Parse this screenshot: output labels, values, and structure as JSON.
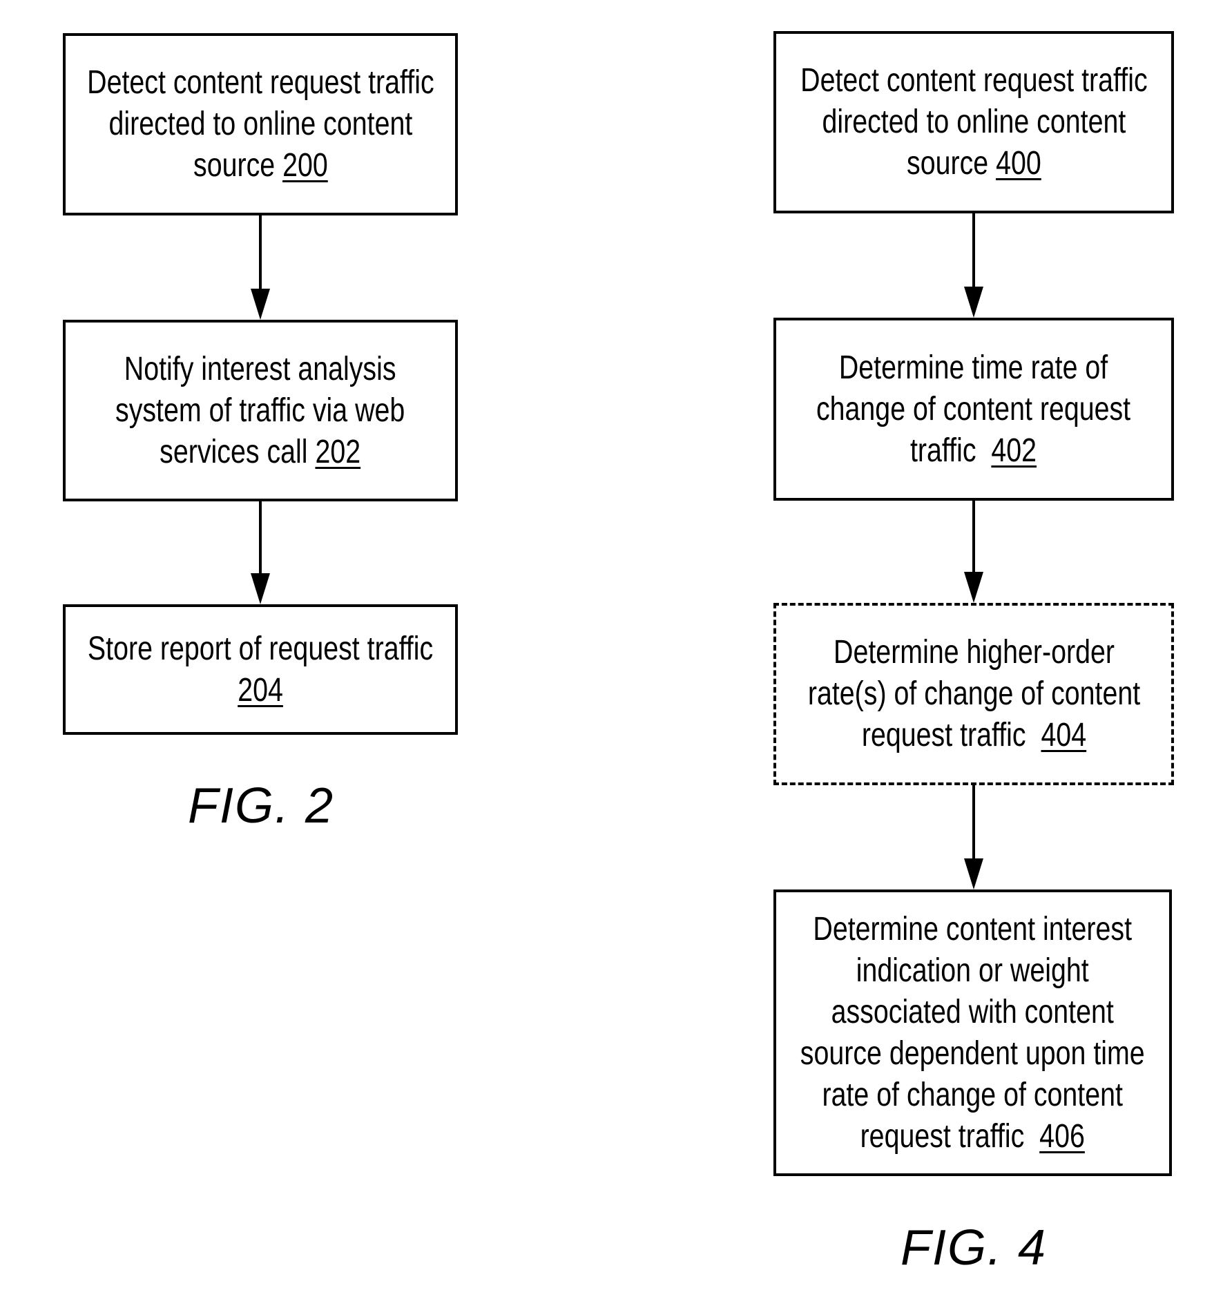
{
  "figures": [
    {
      "label": "FIG. 2",
      "steps": [
        {
          "lines": [
            "Detect content request traffic",
            "directed to online content",
            "source "
          ],
          "ref": "200",
          "style": "solid"
        },
        {
          "lines": [
            "Notify interest analysis",
            "system of traffic via web",
            "services call "
          ],
          "ref": "202",
          "style": "solid"
        },
        {
          "lines": [
            "Store report of request traffic",
            ""
          ],
          "ref": "204",
          "style": "solid"
        }
      ]
    },
    {
      "label": "FIG. 4",
      "steps": [
        {
          "lines": [
            "Detect content request traffic",
            "directed to online content",
            "source "
          ],
          "ref": "400",
          "style": "solid"
        },
        {
          "lines": [
            "Determine time rate of",
            "change of content request",
            "traffic  "
          ],
          "ref": "402",
          "style": "solid"
        },
        {
          "lines": [
            "Determine higher-order",
            "rate(s) of change of content",
            "request traffic  "
          ],
          "ref": "404",
          "style": "dashed"
        },
        {
          "lines": [
            "Determine content interest",
            "indication or weight",
            "associated with content",
            "source dependent upon time",
            "rate of change of content",
            "request traffic  "
          ],
          "ref": "406",
          "style": "solid"
        }
      ]
    }
  ]
}
